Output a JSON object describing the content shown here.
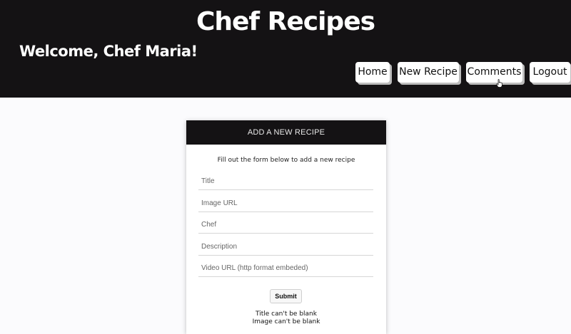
{
  "header": {
    "site_title": "Chef Recipes",
    "welcome": "Welcome, Chef Maria!"
  },
  "nav": {
    "home": "Home",
    "new_recipe": "New Recipe",
    "comments": "Comments",
    "logout": "Logout"
  },
  "form": {
    "heading": "ADD A NEW RECIPE",
    "instructions": "Fill out the form below to add a new recipe",
    "fields": {
      "title_placeholder": "Title",
      "image_placeholder": "Image URL",
      "chef_placeholder": "Chef",
      "description_placeholder": "Description",
      "video_placeholder": "Video URL (http format embeded)"
    },
    "submit_label": "Submit",
    "errors": [
      "Title can't be blank",
      "Image can't be blank"
    ]
  },
  "colors": {
    "header_bg": "#141214",
    "page_bg": "#fbfbfd",
    "button_bg": "#ffffff"
  },
  "icons": {
    "cursor": "hand-pointer-icon"
  }
}
